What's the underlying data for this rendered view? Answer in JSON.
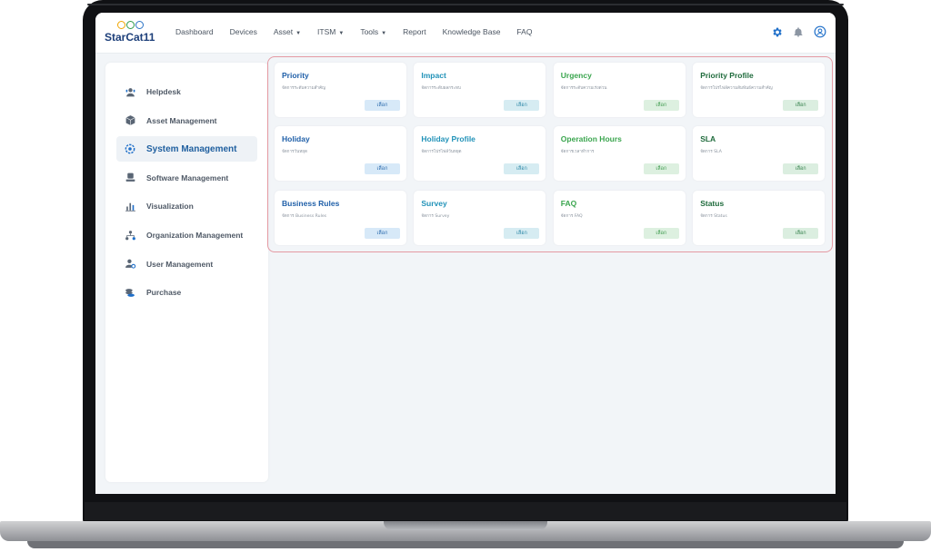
{
  "brand": {
    "name": "StarCat11",
    "dot_colors": [
      "#f0a500",
      "#2e9b4a",
      "#2b73c6"
    ]
  },
  "nav": {
    "items": [
      {
        "label": "Dashboard",
        "dropdown": false
      },
      {
        "label": "Devices",
        "dropdown": false
      },
      {
        "label": "Asset",
        "dropdown": true
      },
      {
        "label": "ITSM",
        "dropdown": true
      },
      {
        "label": "Tools",
        "dropdown": true
      },
      {
        "label": "Report",
        "dropdown": false
      },
      {
        "label": "Knowledge Base",
        "dropdown": false
      },
      {
        "label": "FAQ",
        "dropdown": false
      }
    ],
    "caret": "▼",
    "icons": [
      "gear-icon",
      "bell-icon",
      "user-profile-icon"
    ],
    "accent_color": "#1f6fc9"
  },
  "sidebar": {
    "items": [
      {
        "label": "Helpdesk",
        "icon": "helpdesk-icon",
        "active": false
      },
      {
        "label": "Asset Management",
        "icon": "box-icon",
        "active": false
      },
      {
        "label": "System Management",
        "icon": "gear-icon",
        "active": true
      },
      {
        "label": "Software Management",
        "icon": "software-icon",
        "active": false
      },
      {
        "label": "Visualization",
        "icon": "bar-chart-icon",
        "active": false
      },
      {
        "label": "Organization Management",
        "icon": "org-chart-icon",
        "active": false
      },
      {
        "label": "User Management",
        "icon": "user-gear-icon",
        "active": false
      },
      {
        "label": "Purchase",
        "icon": "coins-icon",
        "active": false
      }
    ]
  },
  "cards": [
    {
      "title": "Priority",
      "desc": "จัดการระดับความสำคัญ",
      "button": "เลือก",
      "theme": "blue"
    },
    {
      "title": "Impact",
      "desc": "จัดการระดับผลกระทบ",
      "button": "เลือก",
      "theme": "teal"
    },
    {
      "title": "Urgency",
      "desc": "จัดการระดับความเร่งด่วน",
      "button": "เลือก",
      "theme": "green"
    },
    {
      "title": "Priority Profile",
      "desc": "จัดการโปรไฟล์ความสัมพันธ์ความสำคัญ",
      "button": "เลือก",
      "theme": "darkgreen"
    },
    {
      "title": "Holiday",
      "desc": "จัดการวันหยุด",
      "button": "เลือก",
      "theme": "blue"
    },
    {
      "title": "Holiday Profile",
      "desc": "จัดการโปรไฟล์วันหยุด",
      "button": "เลือก",
      "theme": "teal"
    },
    {
      "title": "Operation Hours",
      "desc": "จัดการเวลาทำการ",
      "button": "เลือก",
      "theme": "green"
    },
    {
      "title": "SLA",
      "desc": "จัดการ SLA",
      "button": "เลือก",
      "theme": "darkgreen"
    },
    {
      "title": "Business Rules",
      "desc": "จัดการ Business Rules",
      "button": "เลือก",
      "theme": "blue"
    },
    {
      "title": "Survey",
      "desc": "จัดการ Survey",
      "button": "เลือก",
      "theme": "teal"
    },
    {
      "title": "FAQ",
      "desc": "จัดการ FAQ",
      "button": "เลือก",
      "theme": "green"
    },
    {
      "title": "Status",
      "desc": "จัดการ Status",
      "button": "เลือก",
      "theme": "darkgreen"
    }
  ],
  "themes": {
    "blue": {
      "title": "#1f5fa8",
      "btn_bg": "#d7e9f8",
      "btn_text": "#2a6aac"
    },
    "teal": {
      "title": "#2192b8",
      "btn_bg": "#d6ecf2",
      "btn_text": "#2a86a6"
    },
    "green": {
      "title": "#3aa54e",
      "btn_bg": "#ddf0e0",
      "btn_text": "#3d9a4c"
    },
    "darkgreen": {
      "title": "#1f6b3c",
      "btn_bg": "#dbeee0",
      "btn_text": "#2f7d46"
    }
  }
}
